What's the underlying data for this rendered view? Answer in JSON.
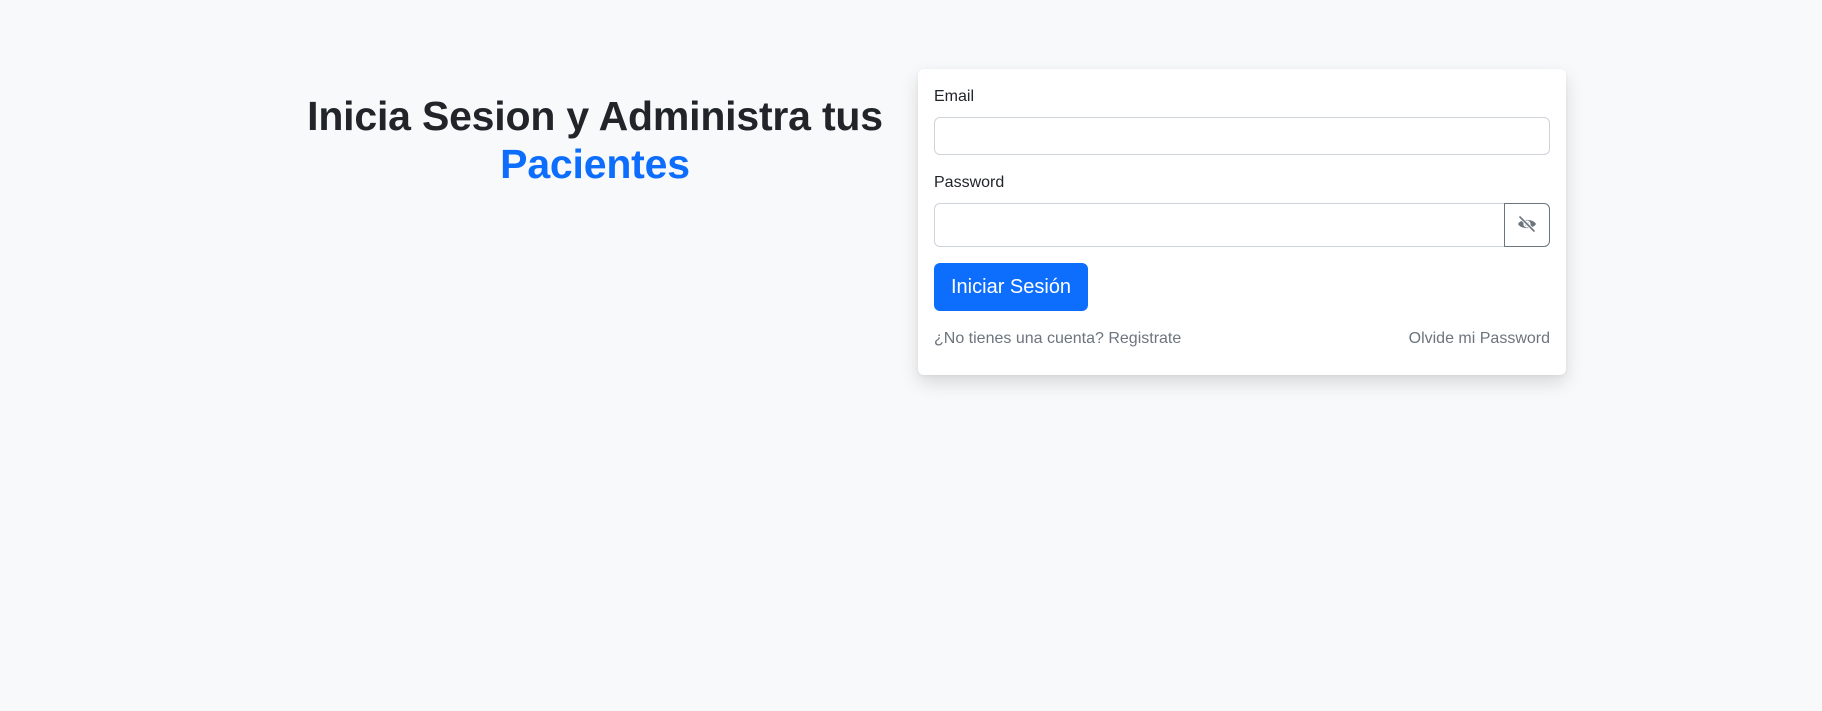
{
  "hero": {
    "title_line1": "Inicia Sesion y Administra tus",
    "title_accent": "Pacientes"
  },
  "form": {
    "email_label": "Email",
    "email_value": "",
    "email_placeholder": "",
    "password_label": "Password",
    "password_value": "",
    "password_placeholder": "",
    "toggle_icon": "eye-slash-icon",
    "submit_label": "Iniciar Sesión",
    "register_link": "¿No tienes una cuenta? Registrate",
    "forgot_link": "Olvide mi Password"
  },
  "colors": {
    "background": "#f8f9fa",
    "accent": "#0d6efd",
    "text": "#212529",
    "muted": "#6c757d"
  }
}
